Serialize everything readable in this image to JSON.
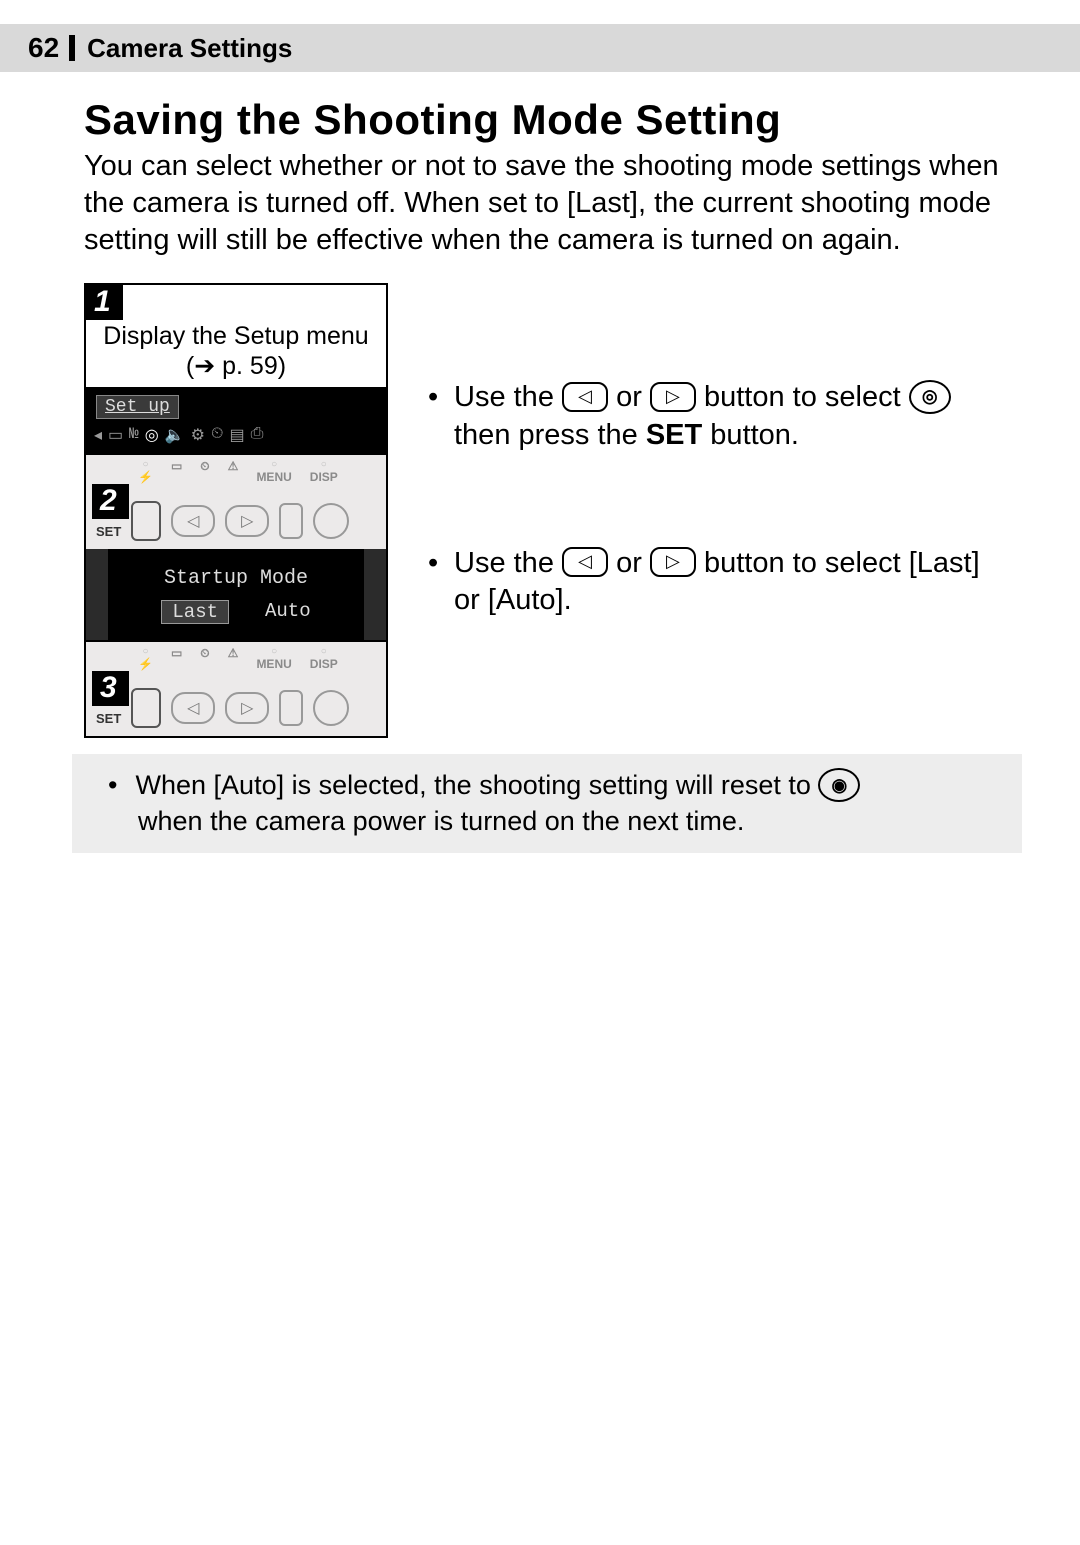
{
  "header": {
    "page_number": "62",
    "section": "Camera Settings"
  },
  "title": "Saving the Shooting Mode Setting",
  "intro": "You can select whether or not to save the shooting mode settings when the camera is turned off. When set to [Last], the current shooting mode setting will still be effective when the camera is turned on again.",
  "steps": {
    "s1": {
      "num": "1",
      "text_a": "Display the Setup menu",
      "text_b": "(➔ p. 59)",
      "screen_tab": "Set up"
    },
    "s2": {
      "num": "2",
      "set_label": "SET",
      "menu_label": "MENU",
      "disp_label": "DISP",
      "screen_title": "Startup Mode",
      "opt_last": "Last",
      "opt_auto": "Auto"
    },
    "s3": {
      "num": "3",
      "set_label": "SET",
      "menu_label": "MENU",
      "disp_label": "DISP"
    }
  },
  "bullets": {
    "b1_a": "Use the ",
    "b1_b": " or ",
    "b1_c": " button to select ",
    "b1_d": " then press the ",
    "b1_set": "SET",
    "b1_e": " button.",
    "b2_a": "Use the ",
    "b2_b": " or ",
    "b2_c": " button to select [Last] or [Auto]."
  },
  "note": {
    "a": "When [Auto] is selected, the shooting setting will reset to ",
    "b": " when the camera power is turned on the next time."
  },
  "icons": {
    "left": "◁",
    "right": "▷",
    "camera": "◉",
    "camera_ring": "◎",
    "flash": "⚡",
    "timer": "⏲",
    "warn": "⚠",
    "arrow_left": "◂",
    "speaker": "🔈",
    "gear": "⚙",
    "lcd": "▭"
  }
}
